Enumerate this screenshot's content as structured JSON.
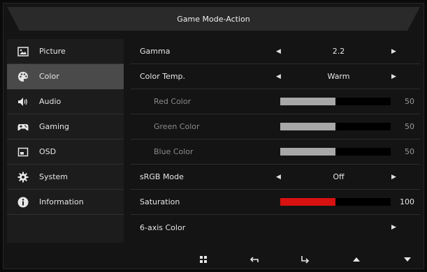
{
  "title": "Game Mode-Action",
  "sidebar": {
    "items": [
      {
        "label": "Picture",
        "icon": "picture-icon"
      },
      {
        "label": "Color",
        "icon": "palette-icon",
        "active": true
      },
      {
        "label": "Audio",
        "icon": "speaker-icon"
      },
      {
        "label": "Gaming",
        "icon": "gamepad-icon"
      },
      {
        "label": "OSD",
        "icon": "osd-icon"
      },
      {
        "label": "System",
        "icon": "gear-icon"
      },
      {
        "label": "Information",
        "icon": "info-icon"
      }
    ]
  },
  "settings": {
    "gamma": {
      "label": "Gamma",
      "value": "2.2"
    },
    "color_temp": {
      "label": "Color Temp.",
      "value": "Warm"
    },
    "red": {
      "label": "Red Color",
      "value": "50"
    },
    "green": {
      "label": "Green Color",
      "value": "50"
    },
    "blue": {
      "label": "Blue Color",
      "value": "50"
    },
    "srgb": {
      "label": "sRGB Mode",
      "value": "Off"
    },
    "saturation": {
      "label": "Saturation",
      "value": "100"
    },
    "six_axis": {
      "label": "6-axis Color"
    }
  },
  "colors": {
    "accent_red": "#d81111",
    "active_bg": "#4a4a4a"
  },
  "bottom_buttons": [
    "menu-grid-icon",
    "back-icon",
    "enter-icon",
    "up-icon",
    "down-icon"
  ]
}
